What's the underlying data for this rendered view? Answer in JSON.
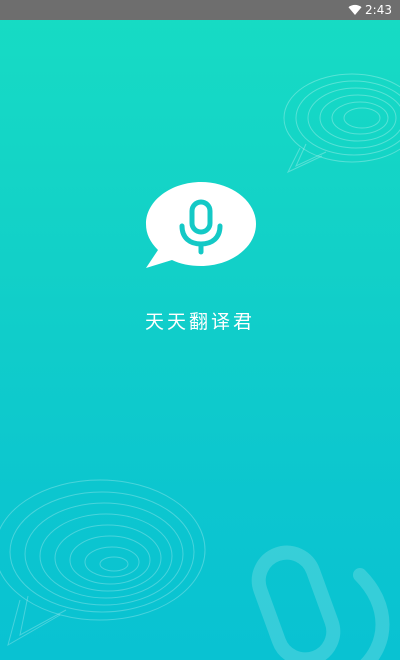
{
  "status_bar": {
    "time": "2:43",
    "wifi_icon": "wifi-icon"
  },
  "splash": {
    "app_name": "天天翻译君",
    "logo_icon": "speech-bubble-microphone-icon"
  },
  "colors": {
    "gradient_top": "#17dcc4",
    "gradient_bottom": "#09c2d2",
    "status_bar_bg": "#6e6e6e",
    "logo_bubble": "#ffffff",
    "logo_mic": "#14c9c6",
    "text": "#ffffff"
  }
}
